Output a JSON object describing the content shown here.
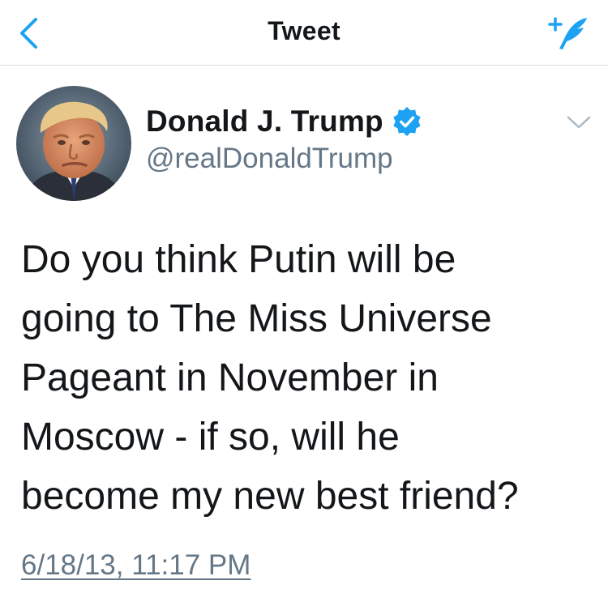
{
  "navbar": {
    "title": "Tweet",
    "back_icon": "chevron-left-icon",
    "compose_icon": "compose-tweet-icon",
    "accent_color": "#1da1f2"
  },
  "tweet": {
    "author": {
      "display_name": "Donald J. Trump",
      "handle": "@realDonaldTrump",
      "verified": true
    },
    "text_lines": [
      "Do you think Putin will be",
      "going to The Miss Universe",
      "Pageant in November in",
      "Moscow - if so, will he",
      "become my new best friend?"
    ],
    "timestamp": "6/18/13, 11:17 PM"
  },
  "colors": {
    "text": "#14171a",
    "secondary_text": "#657786",
    "verified_badge": "#1da1f2",
    "divider": "#d8dde1"
  }
}
